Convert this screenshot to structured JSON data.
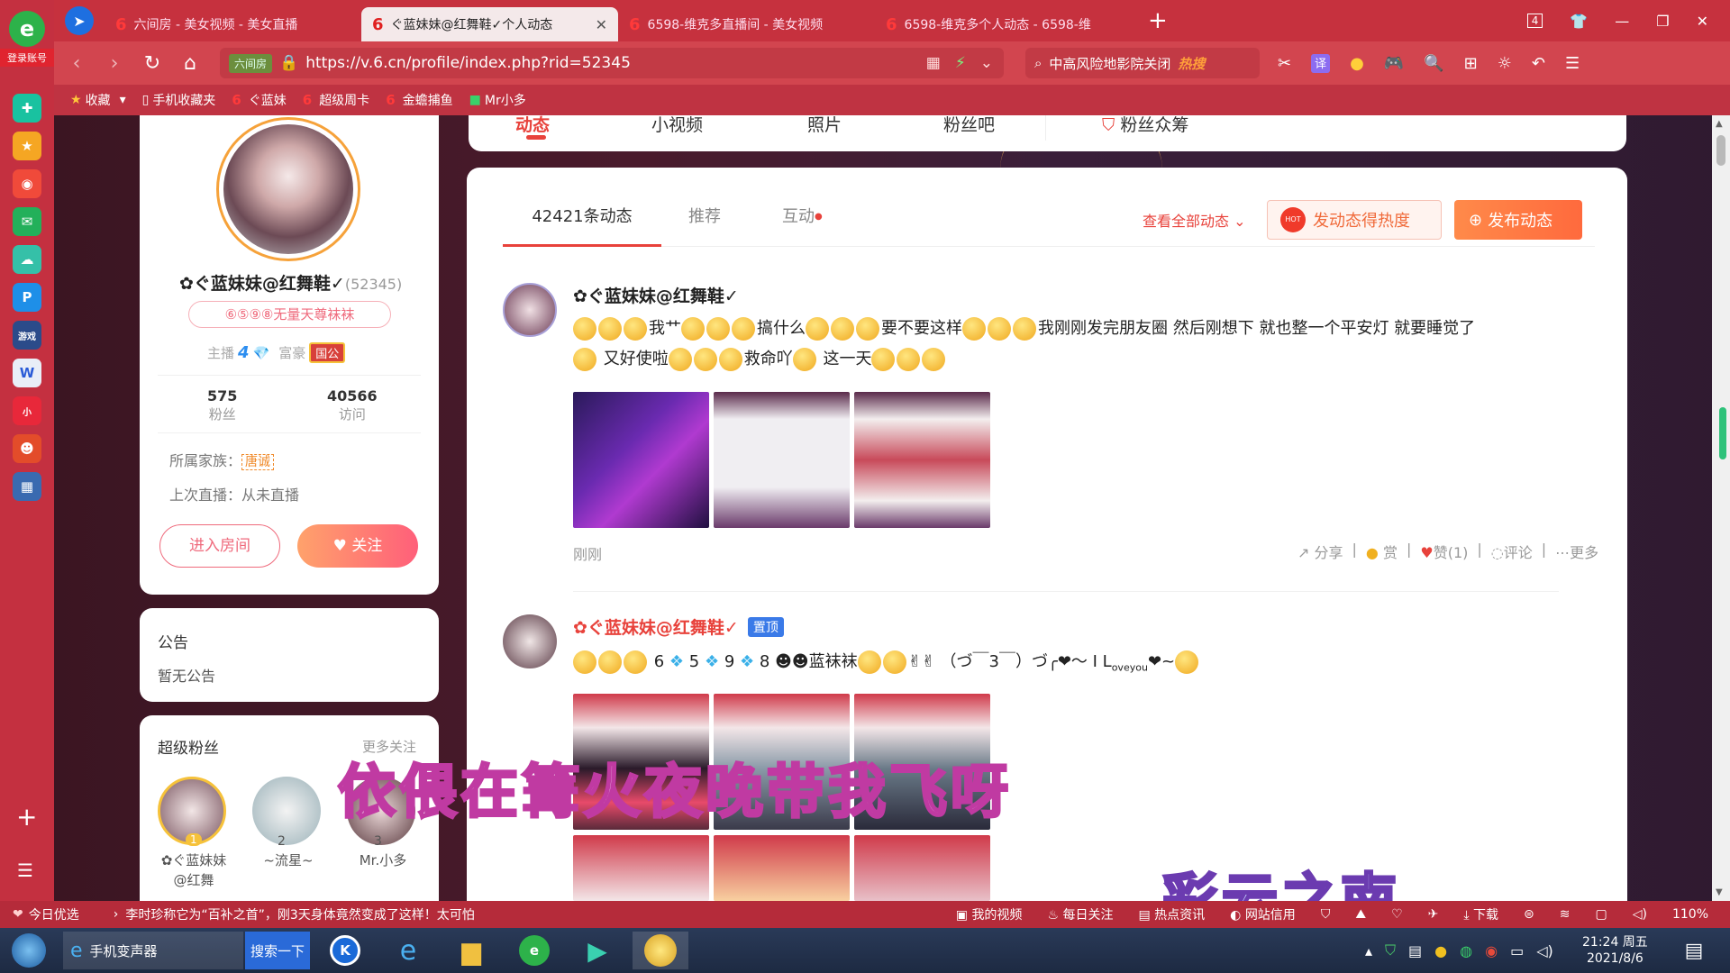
{
  "tabs": [
    {
      "label": "六间房 - 美女视频 - 美女直播",
      "active": false
    },
    {
      "label": "ぐ蓝妹妹@红舞鞋✓个人动态",
      "active": true
    },
    {
      "label": "6598-维克多直播间 - 美女视频",
      "active": false
    },
    {
      "label": "6598-维克多个人动态 - 6598-维",
      "active": false
    }
  ],
  "tab_count": "4",
  "login_label": "登录账号",
  "url": "https://v.6.cn/profile/index.php?rid=52345",
  "url_badge": "六间房",
  "search": {
    "text": "中高风险地影院关闭",
    "hot": "热搜"
  },
  "translate_label": "译",
  "favorites": [
    "收藏",
    "手机收藏夹",
    "ぐ蓝妹",
    "超级周卡",
    "金蟾捕鱼",
    "Mr小多"
  ],
  "profile": {
    "name": "✿ぐ蓝妹妹@红舞鞋✓",
    "rid": "(52345)",
    "tagline": "⑥⑤⑨⑧无量天尊袜袜",
    "host_label": "主播",
    "host_level": "4",
    "rich_label": "富豪",
    "rich_badge": "国公",
    "fans_count": "575",
    "fans_label": "粉丝",
    "visits_count": "40566",
    "visits_label": "访问",
    "family_label": "所属家族：",
    "family_value": "唐诚",
    "last_live": "上次直播：从未直播",
    "enter_room": "进入房间",
    "follow": "关注"
  },
  "notice": {
    "title": "公告",
    "content": "暂无公告"
  },
  "superfans": {
    "title": "超级粉丝",
    "more": "更多关注",
    "fans": [
      {
        "rank": "1",
        "name": "✿ぐ蓝妹妹@红舞"
      },
      {
        "rank": "2",
        "name": "~流星~"
      },
      {
        "rank": "3",
        "name": "Mr.小多"
      }
    ]
  },
  "top_tabs": [
    "动态",
    "小视频",
    "照片",
    "粉丝吧",
    "粉丝众筹"
  ],
  "feed_tabs": [
    "42421条动态",
    "推荐",
    "互动"
  ],
  "view_all": "查看全部动态",
  "hot_button": "发动态得热度",
  "hot_badge": "HOT",
  "post_button": "发布动态",
  "posts": [
    {
      "author": "✿ぐ蓝妹妹@红舞鞋✓",
      "pinned": "",
      "text_parts": [
        "我艹",
        "搞什么",
        "要不要这样",
        "我刚刚发完朋友圈 然后刚想下 就也整一个平安灯 就要睡觉了",
        "又好使啦",
        "救命吖",
        "这一天"
      ],
      "time": "刚刚",
      "actions": {
        "share": "分享",
        "reward": "赏",
        "like": "赞(1)",
        "comment": "评论",
        "more": "更多"
      }
    },
    {
      "author": "✿ぐ蓝妹妹@红舞鞋✓",
      "pinned": "置顶",
      "text_parts": [
        "6",
        "5",
        "9",
        "8",
        "蓝袜袜",
        "（づ￣3￣）づ╭❤～ I L",
        "ove",
        "you",
        "❤~"
      ]
    }
  ],
  "overlay_text": "依偎在篝火夜晚带我飞呀",
  "overlay_text2": "彩云之南",
  "bottom": {
    "left1": "今日优选",
    "news": "李时珍称它为“百补之首”，刚3天身体竟然变成了这样！太可怕",
    "items": [
      "我的视频",
      "每日关注",
      "热点资讯",
      "网站信用",
      "下载"
    ],
    "zoom": "110%"
  },
  "taskbar": {
    "app1": "手机变声器",
    "search": "搜索一下",
    "time": "21:24 周五",
    "date": "2021/8/6"
  },
  "colors": {
    "brand_red": "#c6313e",
    "accent_orange": "#ff6a3d",
    "follow_pink": "#ff5f7a",
    "link_red": "#e8423b"
  }
}
